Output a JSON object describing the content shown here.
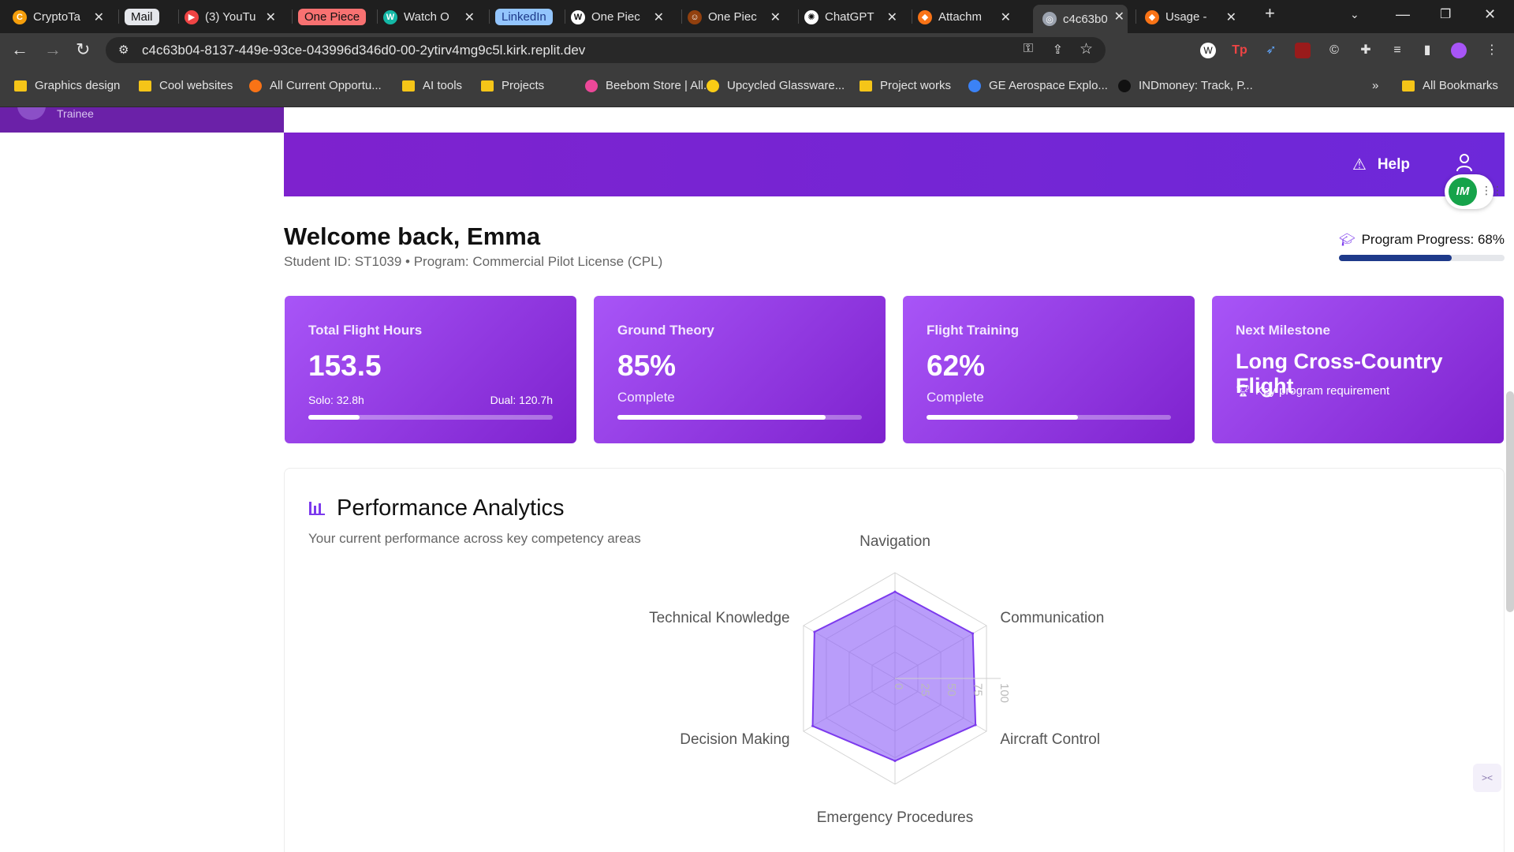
{
  "browser": {
    "tabs": [
      {
        "label": "CryptoTa",
        "favicon_color": "#f59e0b",
        "glyph": "C"
      },
      {
        "label": "Mail",
        "pill": true,
        "pill_bg": "#e5e7eb",
        "pill_fg": "#111111"
      },
      {
        "label": "(3) YouTu",
        "favicon_color": "#ef4444",
        "glyph": "▶"
      },
      {
        "label": "One Piece",
        "pill": true,
        "pill_bg": "#f87171",
        "pill_fg": "#111111"
      },
      {
        "label": "Watch O",
        "favicon_color": "#14b8a6",
        "glyph": "W"
      },
      {
        "label": "LinkedIn",
        "pill": true,
        "pill_bg": "#93c5fd",
        "pill_fg": "#1e3a8a"
      },
      {
        "label": "One Piec",
        "favicon_color": "#ffffff",
        "glyph": "W"
      },
      {
        "label": "One Piec",
        "favicon_color": "#92400e",
        "glyph": "☺"
      },
      {
        "label": "ChatGPT",
        "favicon_color": "#ffffff",
        "glyph": "✺"
      },
      {
        "label": "Attachm",
        "favicon_color": "#f97316",
        "glyph": "◆"
      },
      {
        "label": "c4c63b0",
        "favicon_color": "#9ca3af",
        "glyph": "◎",
        "active": true
      },
      {
        "label": "Usage -",
        "favicon_color": "#f97316",
        "glyph": "◆"
      }
    ],
    "url": "c4c63b04-8137-449e-93ce-043996d346d0-00-2ytirv4mg9c5l.kirk.replit.dev",
    "bookmarks": [
      {
        "label": "Graphics design",
        "type": "folder"
      },
      {
        "label": "Cool websites",
        "type": "folder"
      },
      {
        "label": "All Current Opportu...",
        "type": "site",
        "color": "#f97316"
      },
      {
        "label": "AI tools",
        "type": "folder"
      },
      {
        "label": "Projects",
        "type": "folder"
      },
      {
        "label": "Beebom Store | All...",
        "type": "site",
        "color": "#ec4899"
      },
      {
        "label": "Upcycled Glassware...",
        "type": "site",
        "color": "#facc15"
      },
      {
        "label": "Project works",
        "type": "folder"
      },
      {
        "label": "GE Aerospace Explo...",
        "type": "site",
        "color": "#3b82f6"
      },
      {
        "label": "INDmoney: Track, P...",
        "type": "site",
        "color": "#111111"
      }
    ],
    "more_bookmarks": "»",
    "all_bookmarks": "All Bookmarks"
  },
  "app": {
    "sidebar_role": "Trainee",
    "header": {
      "help_label": "Help",
      "badge_text": "IM"
    },
    "welcome": "Welcome back, Emma",
    "student_line": "Student ID: ST1039 • Program: Commercial Pilot License (CPL)",
    "program_progress": {
      "label": "Program Progress: 68%",
      "value": 0.68
    },
    "cards": [
      {
        "title": "Total Flight Hours",
        "value": "153.5",
        "solo": "Solo: 32.8h",
        "dual": "Dual: 120.7h",
        "progress": 0.21
      },
      {
        "title": "Ground Theory",
        "value": "85%",
        "sub": "Complete",
        "progress": 0.85
      },
      {
        "title": "Flight Training",
        "value": "62%",
        "sub": "Complete",
        "progress": 0.62
      },
      {
        "title": "Next Milestone",
        "value": "Long Cross-Country Flight",
        "note": "Key program requirement"
      }
    ],
    "analytics": {
      "title": "Performance Analytics",
      "subtitle": "Your current performance across key competency areas"
    }
  },
  "chart_data": {
    "type": "radar",
    "axes": [
      "Navigation",
      "Communication",
      "Aircraft Control",
      "Emergency Procedures",
      "Decision Making",
      "Technical Knowledge"
    ],
    "values": [
      82,
      85,
      88,
      78,
      90,
      88
    ],
    "ticks": [
      "0",
      "25",
      "50",
      "75",
      "100"
    ],
    "range": [
      0,
      100
    ],
    "fill_color": "#8b5cf6"
  }
}
